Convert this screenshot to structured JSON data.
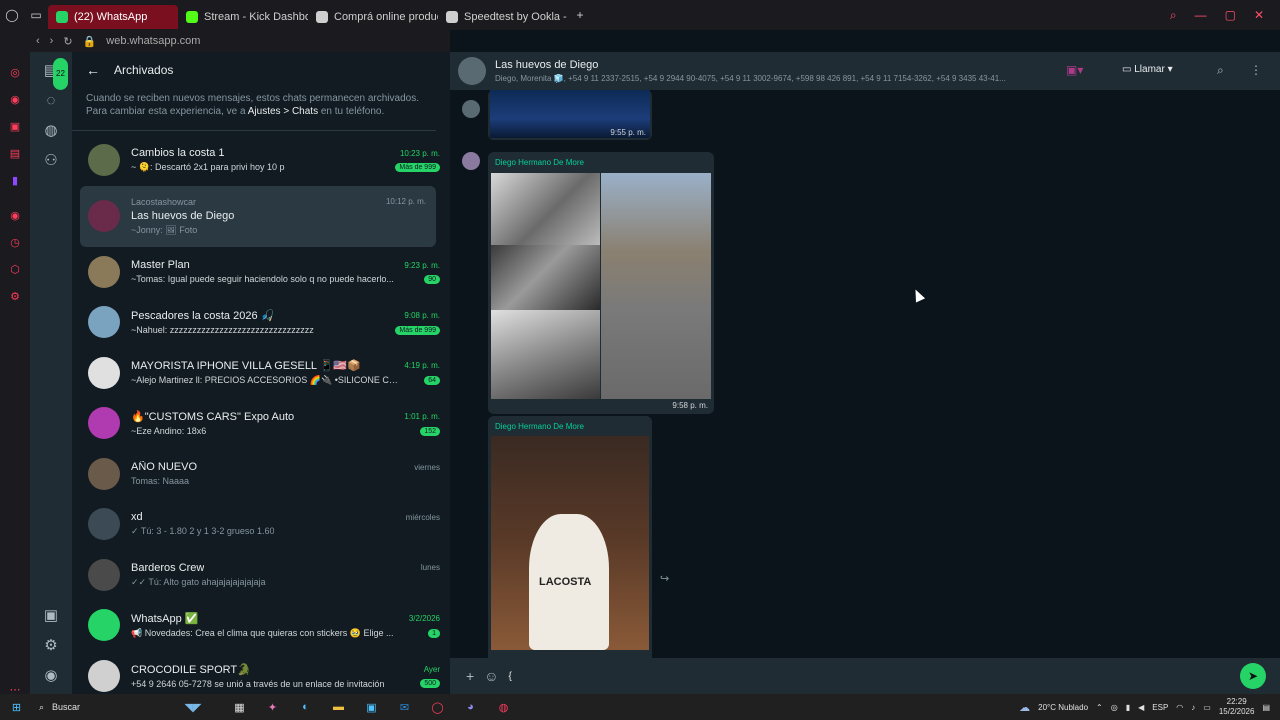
{
  "browser": {
    "tabs": [
      {
        "label": "(22) WhatsApp",
        "active": true,
        "color": "#25d366"
      },
      {
        "label": "Stream - Kick Dashboard",
        "active": false,
        "color": "#53fc18"
      },
      {
        "label": "Comprá online productos",
        "active": false,
        "color": "#cfcfcf"
      },
      {
        "label": "Speedtest by Ookla - The",
        "active": false,
        "color": "#cfcfcf"
      }
    ],
    "url": "web.whatsapp.com"
  },
  "nav": {
    "badge": "22"
  },
  "chatlist": {
    "title": "Archivados",
    "info_prefix": "Cuando se reciben nuevos mensajes, estos chats permanecen archivados. Para cambiar esta experiencia, ve a ",
    "info_bold": "Ajustes > Chats",
    "info_suffix": " en tu teléfono.",
    "chats": [
      {
        "name": "Cambios la costa 1",
        "time": "10:23 p. m.",
        "msg": "~ 🫠: Descartó 2x1 para privi hoy 10 p",
        "badge": "Más de 999",
        "avatar": "#5c6b4a"
      },
      {
        "name": "Las huevos de Diego",
        "sub": "Lacostashowcar",
        "time": "10:12 p. m.",
        "msg": "~Jonny: 🖼 Foto",
        "badge": "",
        "avatar": "#6a2a4a",
        "selected": true
      },
      {
        "name": "Master Plan",
        "time": "9:23 p. m.",
        "msg": "~Tomas: Igual puede seguir haciendolo solo q no puede hacerlo...",
        "badge": "90",
        "avatar": "#8a7a5a"
      },
      {
        "name": "Pescadores la costa 2026 🎣",
        "time": "9:08 p. m.",
        "msg": "~Nahuel: zzzzzzzzzzzzzzzzzzzzzzzzzzzzzzzz",
        "badge": "Más de 999",
        "avatar": "#7aa3c0"
      },
      {
        "name": "MAYORISTA IPHONE VILLA GESELL 📱🇺🇸📦",
        "time": "4:19 p. m.",
        "msg": "~Alejo Martinez ll: PRECIOS ACCESORIOS 🌈🔌 •SILICONE CA...",
        "badge": "64",
        "avatar": "#e0e0e0"
      },
      {
        "name": "🔥\"CUSTOMS CARS\" Expo Auto",
        "time": "1:01 p. m.",
        "msg": "~Eze Andino: 18x6",
        "badge": "152",
        "avatar": "#b03ab0"
      },
      {
        "name": "AÑO NUEVO",
        "time": "viernes",
        "msg": "Tomas: Naaaa",
        "badge": "",
        "avatar": "#6a5a4a",
        "muted": true
      },
      {
        "name": "xd",
        "time": "miércoles",
        "msg": "✓ Tú: 3 - 1.80 2 y 1 3-2 grueso 1.60",
        "badge": "",
        "avatar": "#3b4a54",
        "muted": true
      },
      {
        "name": "Barderos Crew",
        "time": "lunes",
        "msg": "✓✓ Tú: Alto gato ahajajajajajajaja",
        "badge": "",
        "avatar": "#4a4a4a",
        "muted": true
      },
      {
        "name": "WhatsApp ✅",
        "time": "3/2/2026",
        "msg": "📢 Novedades: Crea el clima que quieras con stickers 🥹 Elige ...",
        "badge": "1",
        "avatar": "#25d366"
      },
      {
        "name": "CROCODILE SPORT🐊",
        "time": "Ayer",
        "msg": "+54 9 2646 05-7278 se unió a través de un enlace de invitación",
        "badge": "500",
        "avatar": "#d0d0d0"
      }
    ]
  },
  "conversation": {
    "title": "Las huevos de Diego",
    "members": "Diego, Morenita 🧊, +54 9 11 2337-2515, +54 9 2944 90-4075, +54 9 11 3002-9674, +598 98 426 891, +54 9 11 7154-3262, +54 9 3435 43-41...",
    "call_label": "Llamar",
    "messages": [
      {
        "time": "9:55 p. m."
      },
      {
        "sender": "Diego Hermano De More",
        "time": "9:58 p. m."
      },
      {
        "sender": "Diego Hermano De More",
        "photo_text": "LACOSTA"
      }
    ],
    "composer_value": "{"
  },
  "taskbar": {
    "search": "Buscar",
    "weather": "20°C  Nublado",
    "lang": "ESP",
    "time": "22:29",
    "date": "15/2/2026"
  }
}
